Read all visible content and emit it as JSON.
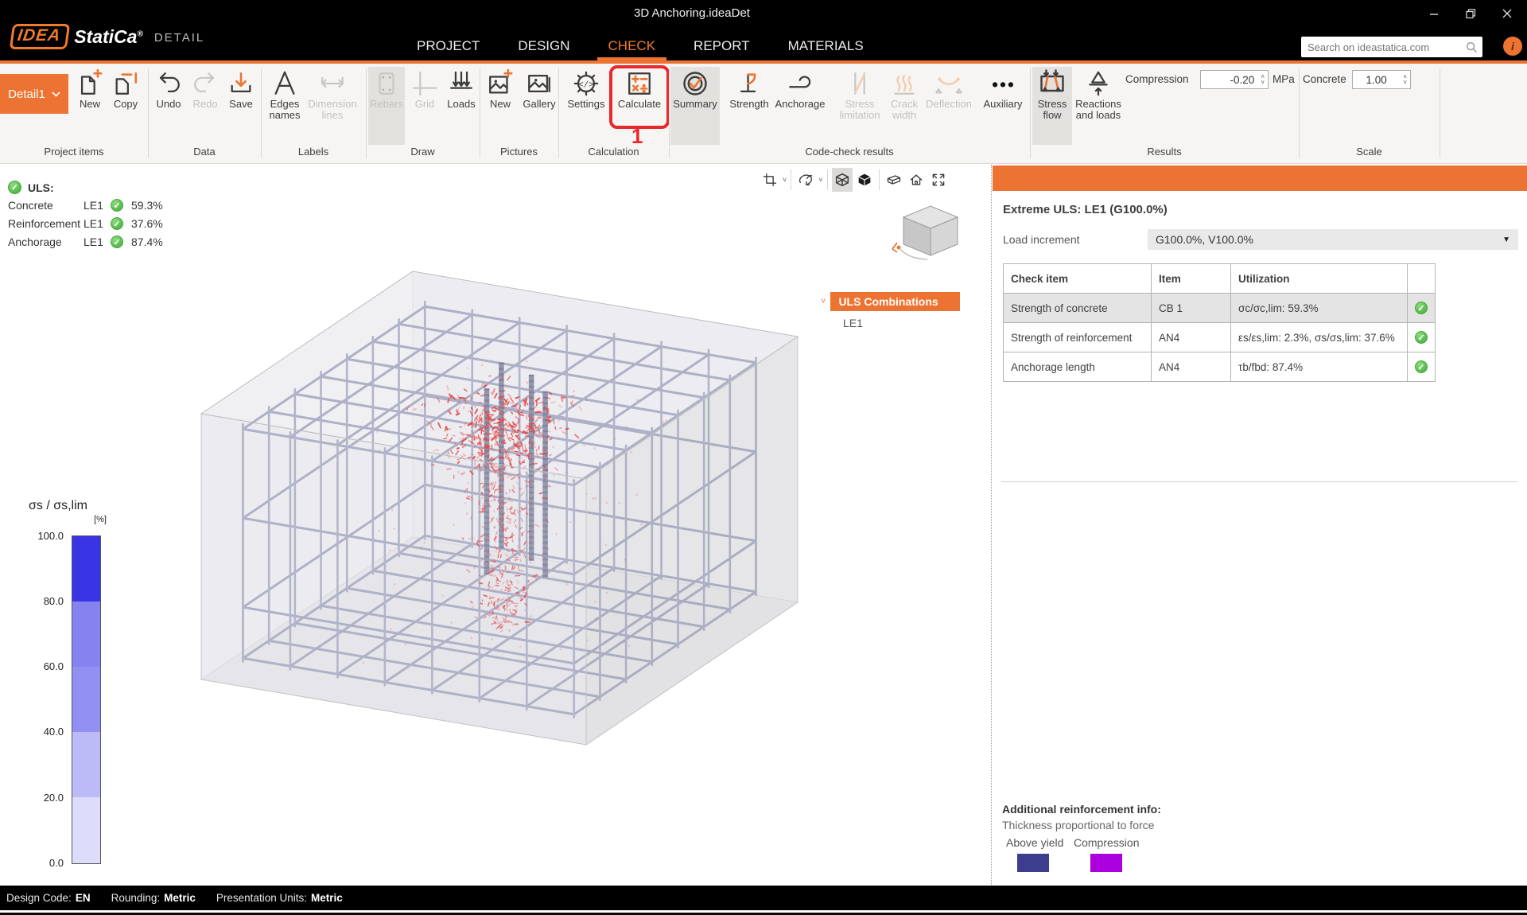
{
  "window": {
    "title": "3D Anchoring.ideaDet"
  },
  "brand": {
    "logo_idea": "IDEA",
    "logo_statica": "StatiCa",
    "logo_reg": "®",
    "product": "DETAIL"
  },
  "menu": {
    "tabs": [
      {
        "label": "PROJECT",
        "active": false
      },
      {
        "label": "DESIGN",
        "active": false
      },
      {
        "label": "CHECK",
        "active": true
      },
      {
        "label": "REPORT",
        "active": false
      },
      {
        "label": "MATERIALS",
        "active": false
      }
    ]
  },
  "search": {
    "placeholder": "Search on ideastatica.com"
  },
  "ribbon": {
    "detail_selector": "Detail1",
    "buttons": {
      "new": "New",
      "copy": "Copy",
      "undo": "Undo",
      "redo": "Redo",
      "save": "Save",
      "edges_names": "Edges names",
      "dimension_lines": "Dimension lines",
      "rebars": "Rebars",
      "grid": "Grid",
      "loads": "Loads",
      "pic_new": "New",
      "gallery": "Gallery",
      "settings": "Settings",
      "calculate": "Calculate",
      "summary": "Summary",
      "strength": "Strength",
      "anchorage": "Anchorage",
      "stress_limitation": "Stress limitation",
      "crack_width": "Crack width",
      "deflection": "Deflection",
      "auxiliary": "Auxiliary",
      "stress_flow": "Stress flow",
      "reactions": "Reactions and loads"
    },
    "compression": {
      "label": "Compression",
      "value": "-0.20",
      "unit": "MPa"
    },
    "concrete_scale": {
      "label": "Concrete",
      "value": "1.00"
    },
    "groups": [
      "Project items",
      "Data",
      "Labels",
      "Draw",
      "Pictures",
      "Calculation",
      "Code-check results",
      "Results",
      "Scale"
    ],
    "annotation_step": "1"
  },
  "canvas": {
    "uls_summary": {
      "title": "ULS:",
      "rows": [
        {
          "name": "Concrete",
          "case": "LE1",
          "value": "59.3%"
        },
        {
          "name": "Reinforcement",
          "case": "LE1",
          "value": "37.6%"
        },
        {
          "name": "Anchorage",
          "case": "LE1",
          "value": "87.4%"
        }
      ]
    },
    "legend": {
      "title": "σs / σs,lim",
      "unit": "[%]",
      "ticks": [
        "100.0",
        "80.0",
        "60.0",
        "40.0",
        "20.0",
        "0.0"
      ],
      "segment_colors": [
        "#3a35e4",
        "#8583ef",
        "#918ff2",
        "#bcbaf7",
        "#dddcfb"
      ]
    },
    "tree": {
      "selected": "ULS Combinations",
      "child": "LE1"
    }
  },
  "right_panel": {
    "extreme_title": "Extreme ULS: LE1 (G100.0%)",
    "load_increment_label": "Load increment",
    "load_increment_value": "G100.0%, V100.0%",
    "table": {
      "headers": [
        "Check item",
        "Item",
        "Utilization"
      ],
      "rows": [
        {
          "check": "Strength of concrete",
          "item": "CB 1",
          "utilization": "σc/σc,lim: 59.3%",
          "status": "pass"
        },
        {
          "check": "Strength of reinforcement",
          "item": "AN4",
          "utilization": "εs/εs,lim: 2.3%, σs/σs,lim: 37.6%",
          "status": "pass"
        },
        {
          "check": "Anchorage length",
          "item": "AN4",
          "utilization": "τb/fbd: 87.4%",
          "status": "pass"
        }
      ]
    },
    "additional_info": {
      "title": "Additional reinforcement info:",
      "subtitle": "Thickness proportional to force",
      "legend": [
        {
          "label": "Above yield",
          "color": "#3d3d8d"
        },
        {
          "label": "Compression",
          "color": "#ab00dd"
        }
      ]
    }
  },
  "status_bar": {
    "items": [
      {
        "label": "Design Code:",
        "value": "EN"
      },
      {
        "label": "Rounding:",
        "value": "Metric"
      },
      {
        "label": "Presentation Units:",
        "value": "Metric"
      }
    ]
  },
  "colors": {
    "accent": "#ed7332",
    "check_green": "#53b84e",
    "highlight_red": "#e7292c"
  }
}
